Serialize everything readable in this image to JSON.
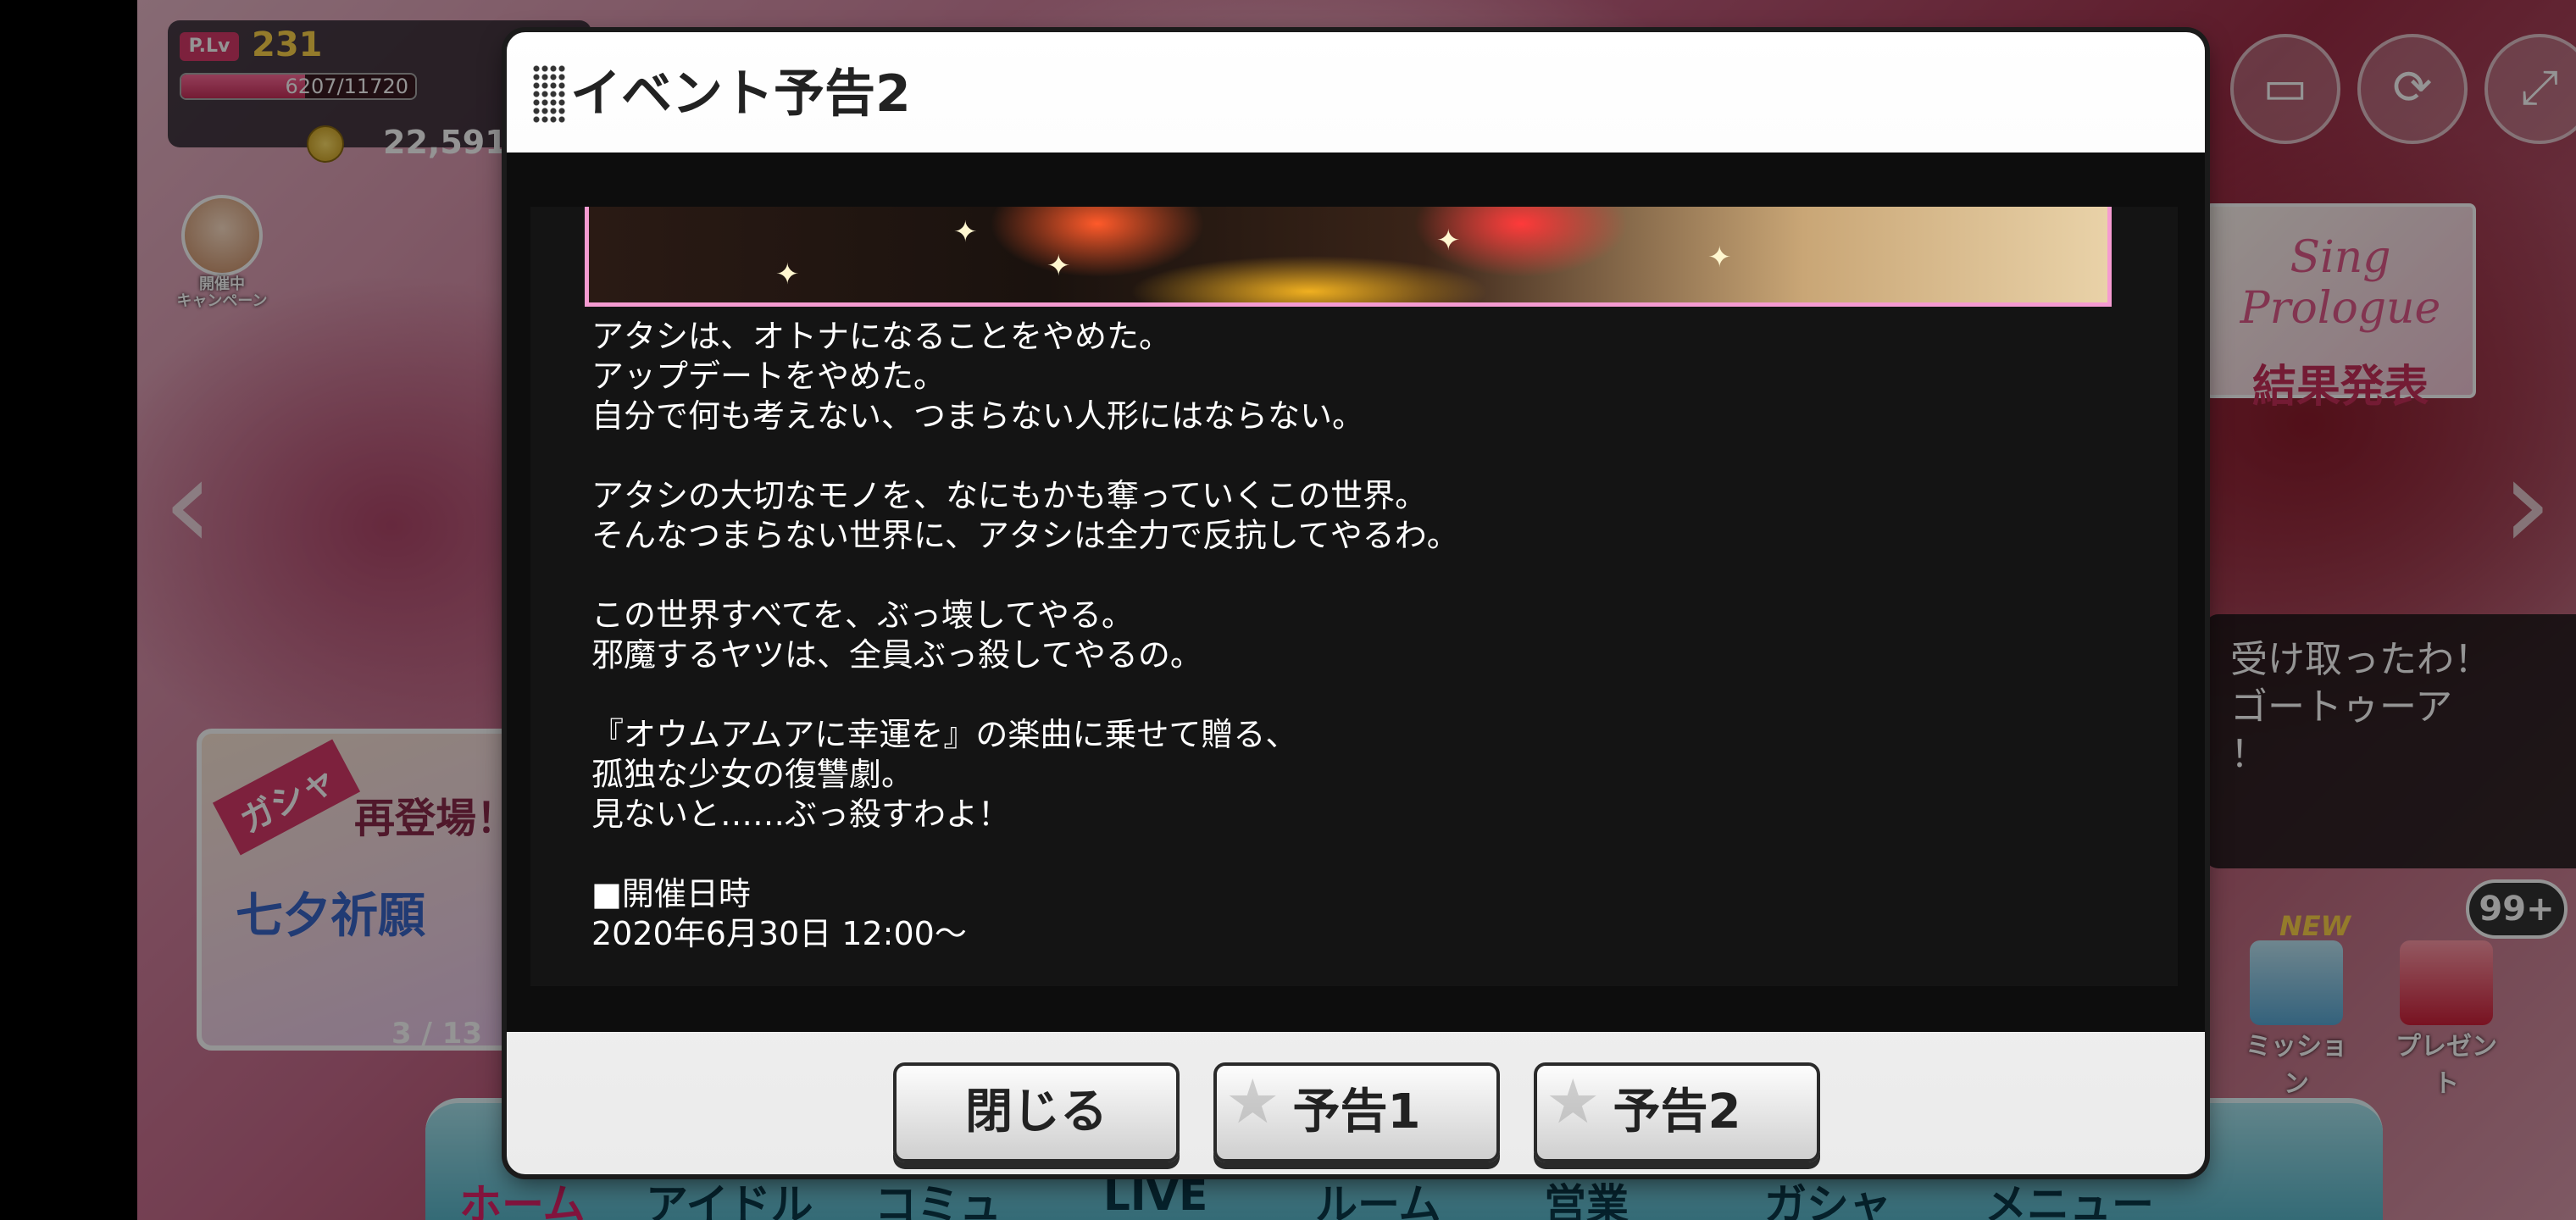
{
  "hud": {
    "plv_tag": "P.Lv",
    "plv_value": "231",
    "exp_text": "6207/11720",
    "exp_fraction": 0.53,
    "money": "22,591"
  },
  "campaign": {
    "label": "開催中\nキャンペーン"
  },
  "event_banner": {
    "logo": "Sing Prologue",
    "result": "結果発表"
  },
  "talk_bubble": {
    "line1": "受け取ったわ！",
    "line2": "ゴートゥーア",
    "line3": "！"
  },
  "gacha": {
    "tag": "ガシャ",
    "title": "再登場！",
    "subtitle": "七夕祈願",
    "counter": "3 / 13"
  },
  "side_icons": {
    "mission_label": "ミッション",
    "present_label": "プレゼント",
    "new_badge": "NEW",
    "count_badge": "99+"
  },
  "bottom_nav": {
    "home": "ホーム",
    "idol": "アイドル",
    "commu": "コミュ",
    "live": "LIVE",
    "room": "ルーム",
    "business": "営業",
    "gacha": "ガシャ",
    "menu": "メニュー"
  },
  "modal": {
    "title": "イベント予告2",
    "description": [
      "アタシは、オトナになることをやめた。",
      "アップデートをやめた。",
      "自分で何も考えない、つまらない人形にはならない。",
      "",
      "アタシの大切なモノを、なにもかも奪っていくこの世界。",
      "そんなつまらない世界に、アタシは全力で反抗してやるわ。",
      "",
      "この世界すべてを、ぶっ壊してやる。",
      "邪魔するヤツは、全員ぶっ殺してやるの。",
      "",
      "『オウムアムアに幸運を』の楽曲に乗せて贈る、",
      "孤独な少女の復讐劇。",
      "見ないと……ぶっ殺すわよ！",
      "",
      "■開催日時",
      "2020年6月30日 12:00～"
    ],
    "buttons": {
      "close": "閉じる",
      "preview1": "予告1",
      "preview2": "予告2"
    }
  }
}
